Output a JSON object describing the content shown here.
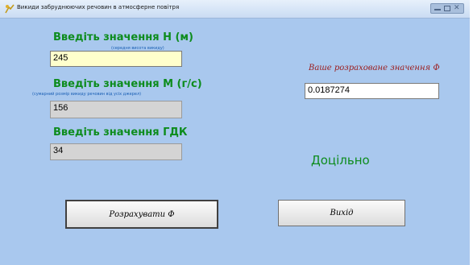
{
  "window": {
    "title": "Викиди забруднюючих речовин в атмосферне повітря"
  },
  "form": {
    "h": {
      "label": "Введіть значення Н (м)",
      "hint": "(середня висота викиду)",
      "value": "245"
    },
    "m": {
      "label": "Введіть значення М (г/с)",
      "hint": "(сумарний розмір викиду речовин від усіх джерел)",
      "value": "156"
    },
    "gdk": {
      "label": "Введіть значення ГДК",
      "value": "34"
    }
  },
  "result": {
    "label": "Ваше розраховане значення Ф",
    "value": "0.0187274",
    "status": "Доцільно"
  },
  "buttons": {
    "calculate": "Розрахувати Ф",
    "exit": "Вихід"
  },
  "colors": {
    "background": "#a9c8ee",
    "label_green": "#0d8c1d",
    "hint_blue": "#1a5fb4",
    "result_label_red": "#9b1d1d",
    "active_field": "#ffffcc",
    "disabled_field": "#d4d4d4"
  },
  "icons": {
    "title": "app-icon"
  }
}
